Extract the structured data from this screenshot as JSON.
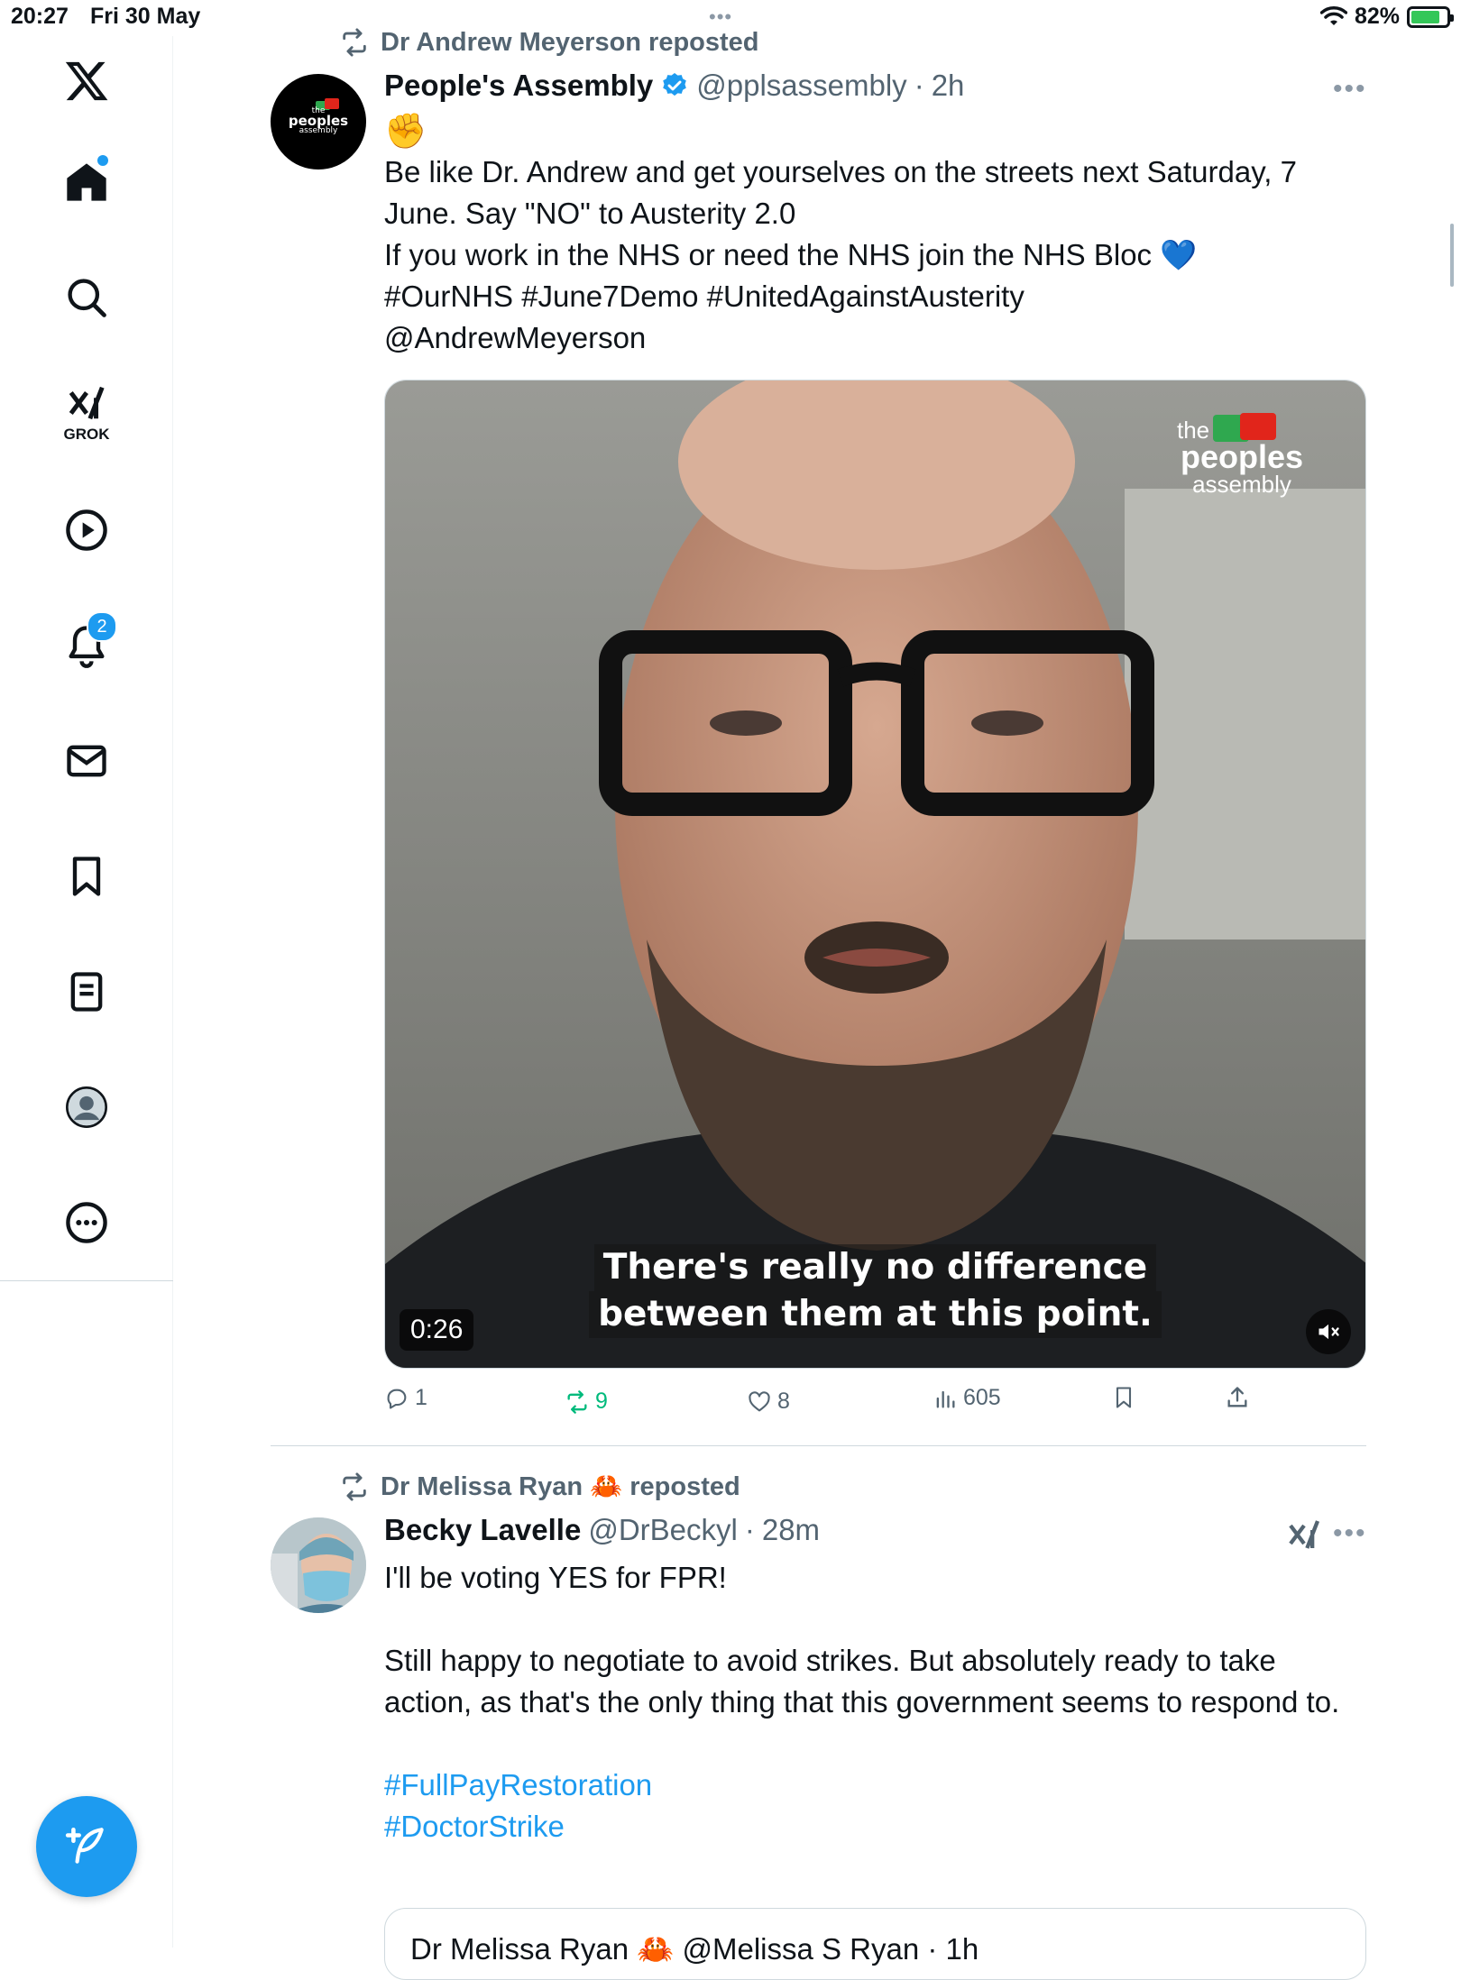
{
  "status_bar": {
    "time": "20:27",
    "date": "Fri 30 May",
    "battery": "82%",
    "battery_level": 0.82,
    "multitask_dots": "•••"
  },
  "sidebar": {
    "items": [
      {
        "id": "x-logo",
        "icon": "x-logo-icon"
      },
      {
        "id": "home",
        "icon": "home-icon",
        "has_dot": true
      },
      {
        "id": "search",
        "icon": "search-icon"
      },
      {
        "id": "grok",
        "icon": "grok-icon",
        "label": "GROK"
      },
      {
        "id": "video",
        "icon": "play-icon"
      },
      {
        "id": "notifications",
        "icon": "bell-icon",
        "badge": "2"
      },
      {
        "id": "messages",
        "icon": "mail-icon"
      },
      {
        "id": "bookmarks",
        "icon": "bookmark-icon"
      },
      {
        "id": "lists",
        "icon": "list-icon"
      },
      {
        "id": "profile",
        "icon": "avatar-icon"
      },
      {
        "id": "more",
        "icon": "more-circle-icon"
      }
    ],
    "compose_icon": "compose-icon"
  },
  "feed": {
    "tweets": [
      {
        "repost_by": "Dr Andrew Meyerson reposted",
        "author_name": "People's Assembly",
        "verified": true,
        "handle": "@pplsassembly",
        "sep": "·",
        "time": "2h",
        "avatar_text_1": "the",
        "avatar_text_2": "peoples",
        "avatar_text_3": "assembly",
        "text_emoji": "✊",
        "text_line_1": "Be like Dr. Andrew and get yourselves on the streets next Saturday, 7 June. Say \"NO\" to Austerity 2.0",
        "text_line_2": "If you work in the NHS or need the NHS join the NHS Bloc",
        "text_heart": "💙",
        "text_hashtags": "#OurNHS #June7Demo #UnitedAgainstAusterity",
        "text_mention": "@AndrewMeyerson",
        "video": {
          "caption_1": "There's really no difference",
          "caption_2": "between them at this point.",
          "duration": "0:26",
          "watermark_1": "the",
          "watermark_2": "peoples",
          "watermark_3": "assembly"
        },
        "actions": {
          "replies": "1",
          "reposts": "9",
          "likes": "8",
          "views": "605"
        }
      },
      {
        "repost_by": "Dr Melissa Ryan 🦀 reposted",
        "author_name": "Becky Lavelle",
        "handle": "@DrBeckyl",
        "sep": "·",
        "time": "28m",
        "text_1": "I'll be voting YES for FPR!",
        "text_2": "Still happy to negotiate to avoid strikes. But absolutely ready to take action, as that's the only thing that this government seems to respond to.",
        "hashtag_1": "#FullPayRestoration",
        "hashtag_2": "#DoctorStrike",
        "quote_preview": "Dr Melissa Ryan 🦀 @Melissa S Ryan · 1h"
      }
    ]
  },
  "colors": {
    "accent": "#1d9bf0",
    "repost_green": "#00ba7c",
    "text": "#0f1419",
    "muted": "#536471"
  }
}
